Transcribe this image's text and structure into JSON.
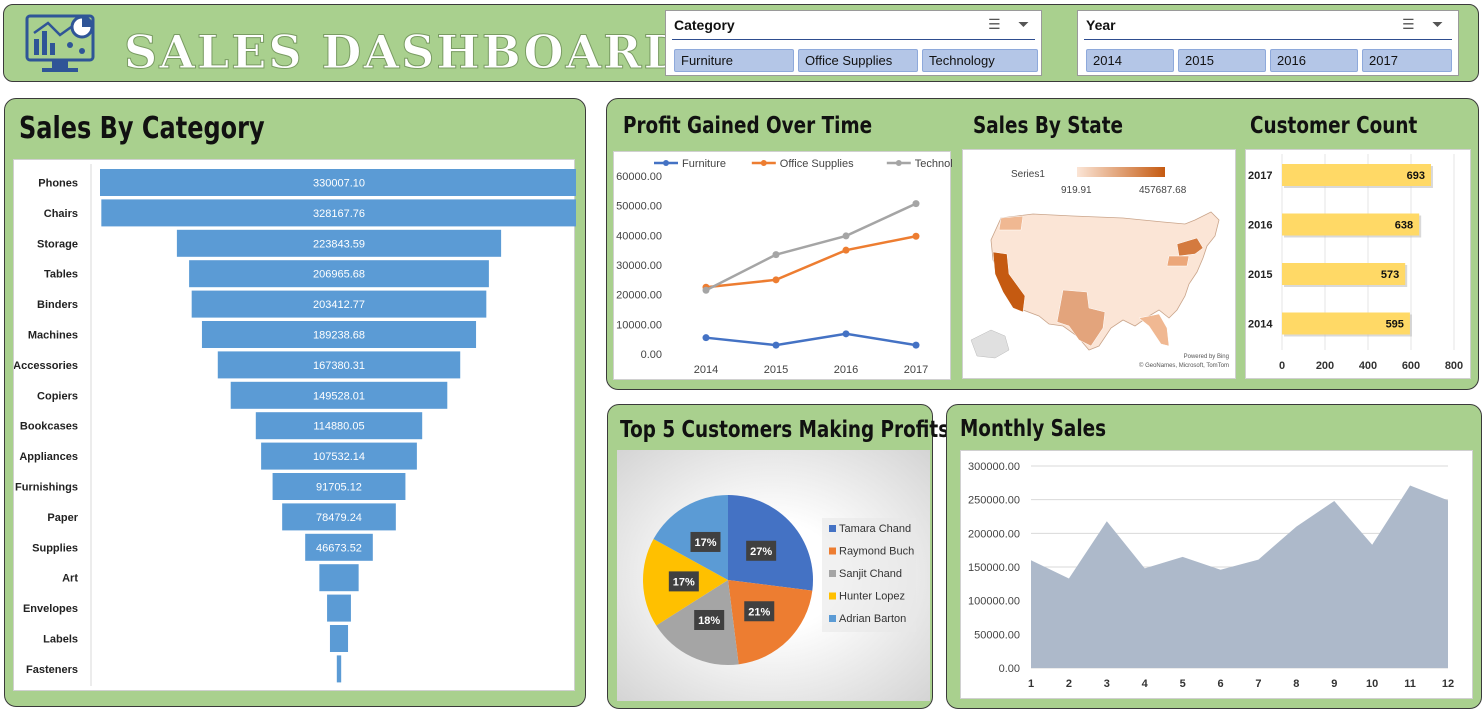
{
  "header": {
    "title": "SALES DASHBOARD",
    "category_slicer": {
      "label": "Category",
      "items": [
        "Furniture",
        "Office Supplies",
        "Technology"
      ]
    },
    "year_slicer": {
      "label": "Year",
      "items": [
        "2014",
        "2015",
        "2016",
        "2017"
      ]
    }
  },
  "panels": {
    "category": "Sales By Category",
    "profit": "Profit Gained Over Time",
    "state": "Sales By State",
    "customer": "Customer Count",
    "top5": "Top 5 Customers Making  Profits",
    "monthly": "Monthly Sales"
  },
  "map": {
    "legend_series": "Series1",
    "min_label": "919.91",
    "max_label": "457687.68",
    "credit1": "Powered by Bing",
    "credit2": "© GeoNames, Microsoft, TomTom",
    "color_low": "#fbe5d6",
    "color_high": "#c55a11"
  },
  "colors": {
    "bar_blue": "#5b9bd5",
    "panel_green": "#a9d08e",
    "gold": "#ffd966",
    "area": "#adb9ca"
  },
  "chart_data": [
    {
      "type": "bar",
      "name": "sales_by_category",
      "title": "Sales By Category",
      "orientation": "horizontal-funnel",
      "categories": [
        "Phones",
        "Chairs",
        "Storage",
        "Tables",
        "Binders",
        "Machines",
        "Accessories",
        "Copiers",
        "Bookcases",
        "Appliances",
        "Furnishings",
        "Paper",
        "Supplies",
        "Art",
        "Envelopes",
        "Labels",
        "Fasteners"
      ],
      "values": [
        330007.1,
        328167.76,
        223843.59,
        206965.68,
        203412.77,
        189238.68,
        167380.31,
        149528.01,
        114880.05,
        107532.14,
        91705.12,
        78479.24,
        46673.52,
        27118.79,
        16476.4,
        12486.31,
        3024.28
      ],
      "labels": [
        "330007.10",
        "328167.76",
        "223843.59",
        "206965.68",
        "203412.77",
        "189238.68",
        "167380.31",
        "149528.01",
        "114880.05",
        "107532.14",
        "91705.12",
        "78479.24",
        "46673.52",
        "",
        "",
        "",
        ""
      ]
    },
    {
      "type": "line",
      "name": "profit_over_time",
      "title": "Profit Gained Over Time",
      "categories": [
        "2014",
        "2015",
        "2016",
        "2017"
      ],
      "series": [
        {
          "name": "Furniture",
          "color": "#4472c4",
          "values": [
            5500,
            3000,
            6800,
            3000
          ]
        },
        {
          "name": "Office Supplies",
          "color": "#ed7d31",
          "values": [
            22500,
            25000,
            35000,
            39700
          ]
        },
        {
          "name": "Technology",
          "color": "#a5a5a5",
          "values": [
            21500,
            33500,
            39800,
            50700
          ]
        }
      ],
      "ylim": [
        0,
        60000
      ],
      "yticks": [
        "0.00",
        "10000.00",
        "20000.00",
        "30000.00",
        "40000.00",
        "50000.00",
        "60000.00"
      ]
    },
    {
      "type": "bar",
      "name": "customer_count",
      "title": "Customer Count",
      "orientation": "horizontal",
      "categories": [
        "2017",
        "2016",
        "2015",
        "2014"
      ],
      "values": [
        693,
        638,
        573,
        595
      ],
      "xlim": [
        0,
        800
      ],
      "xticks": [
        "0",
        "200",
        "400",
        "600",
        "800"
      ]
    },
    {
      "type": "pie",
      "name": "top5_customers",
      "title": "Top 5 Customers Making  Profits",
      "labels": [
        "Tamara Chand",
        "Raymond Buch",
        "Sanjit Chand",
        "Hunter Lopez",
        "Adrian Barton"
      ],
      "values": [
        27,
        21,
        18,
        17,
        17
      ],
      "value_labels": [
        "27%",
        "21%",
        "18%",
        "17%",
        "17%"
      ],
      "colors": [
        "#4472c4",
        "#ed7d31",
        "#a5a5a5",
        "#ffc000",
        "#5b9bd5"
      ]
    },
    {
      "type": "area",
      "name": "monthly_sales",
      "title": "Monthly Sales",
      "x": [
        "1",
        "2",
        "3",
        "4",
        "5",
        "6",
        "7",
        "8",
        "9",
        "10",
        "11",
        "12"
      ],
      "values": [
        160000,
        133000,
        218000,
        148000,
        165000,
        146000,
        161000,
        210000,
        248000,
        183000,
        271000,
        249000
      ],
      "ylim": [
        0,
        300000
      ],
      "yticks": [
        "0.00",
        "50000.00",
        "100000.00",
        "150000.00",
        "200000.00",
        "250000.00",
        "300000.00"
      ]
    }
  ]
}
